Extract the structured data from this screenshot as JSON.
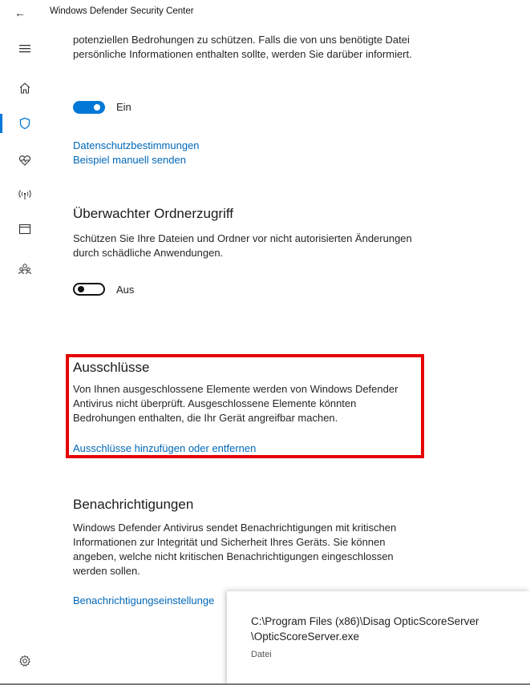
{
  "window": {
    "title": "Windows Defender Security Center",
    "back_glyph": "←"
  },
  "nav": {
    "items": [
      {
        "name": "menu",
        "icon": "hamburger-icon"
      },
      {
        "name": "home",
        "icon": "home-icon"
      },
      {
        "name": "virus-protection",
        "icon": "shield-icon",
        "active": true
      },
      {
        "name": "device-health",
        "icon": "heart-pulse-icon"
      },
      {
        "name": "firewall-network",
        "icon": "antenna-icon"
      },
      {
        "name": "app-browser-control",
        "icon": "browser-window-icon"
      },
      {
        "name": "family-options",
        "icon": "family-icon"
      },
      {
        "name": "settings",
        "icon": "gear-icon"
      }
    ],
    "accent_color": "#0078d7"
  },
  "cloud": {
    "description_line1": "potenziellen Bedrohungen zu schützen. Falls die von uns benötigte Datei",
    "description_line2": "persönliche Informationen enthalten sollte, werden Sie darüber informiert.",
    "toggle_state": "on",
    "toggle_label": "Ein",
    "privacy_link": "Datenschutzbestimmungen",
    "submit_link": "Beispiel manuell senden"
  },
  "folder_access": {
    "title": "Überwachter Ordnerzugriff",
    "description_line1": "Schützen Sie Ihre Dateien und Ordner vor nicht autorisierten Änderungen",
    "description_line2": "durch schädliche Anwendungen.",
    "toggle_state": "off",
    "toggle_label": "Aus"
  },
  "exclusions": {
    "title": "Ausschlüsse",
    "description_line1": "Von Ihnen ausgeschlossene Elemente werden von Windows Defender",
    "description_line2": "Antivirus nicht überprüft. Ausgeschlossene Elemente könnten",
    "description_line3": "Bedrohungen enthalten, die Ihr Gerät angreifbar machen.",
    "link": "Ausschlüsse hinzufügen oder entfernen",
    "highlight_color": "#e60000"
  },
  "notifications": {
    "title": "Benachrichtigungen",
    "description_line1": "Windows Defender Antivirus sendet Benachrichtigungen mit kritischen",
    "description_line2": "Informationen zur Integrität und Sicherheit Ihres Geräts. Sie können",
    "description_line3": "angeben, welche nicht kritischen Benachrichtigungen eingeschlossen",
    "description_line4": "werden sollen.",
    "link": "Benachrichtigungseinstellunge"
  },
  "tooltip": {
    "path_line1": "C:\\Program Files (x86)\\Disag OpticScoreServer",
    "path_line2": "\\OpticScoreServer.exe",
    "type": "Datei"
  }
}
